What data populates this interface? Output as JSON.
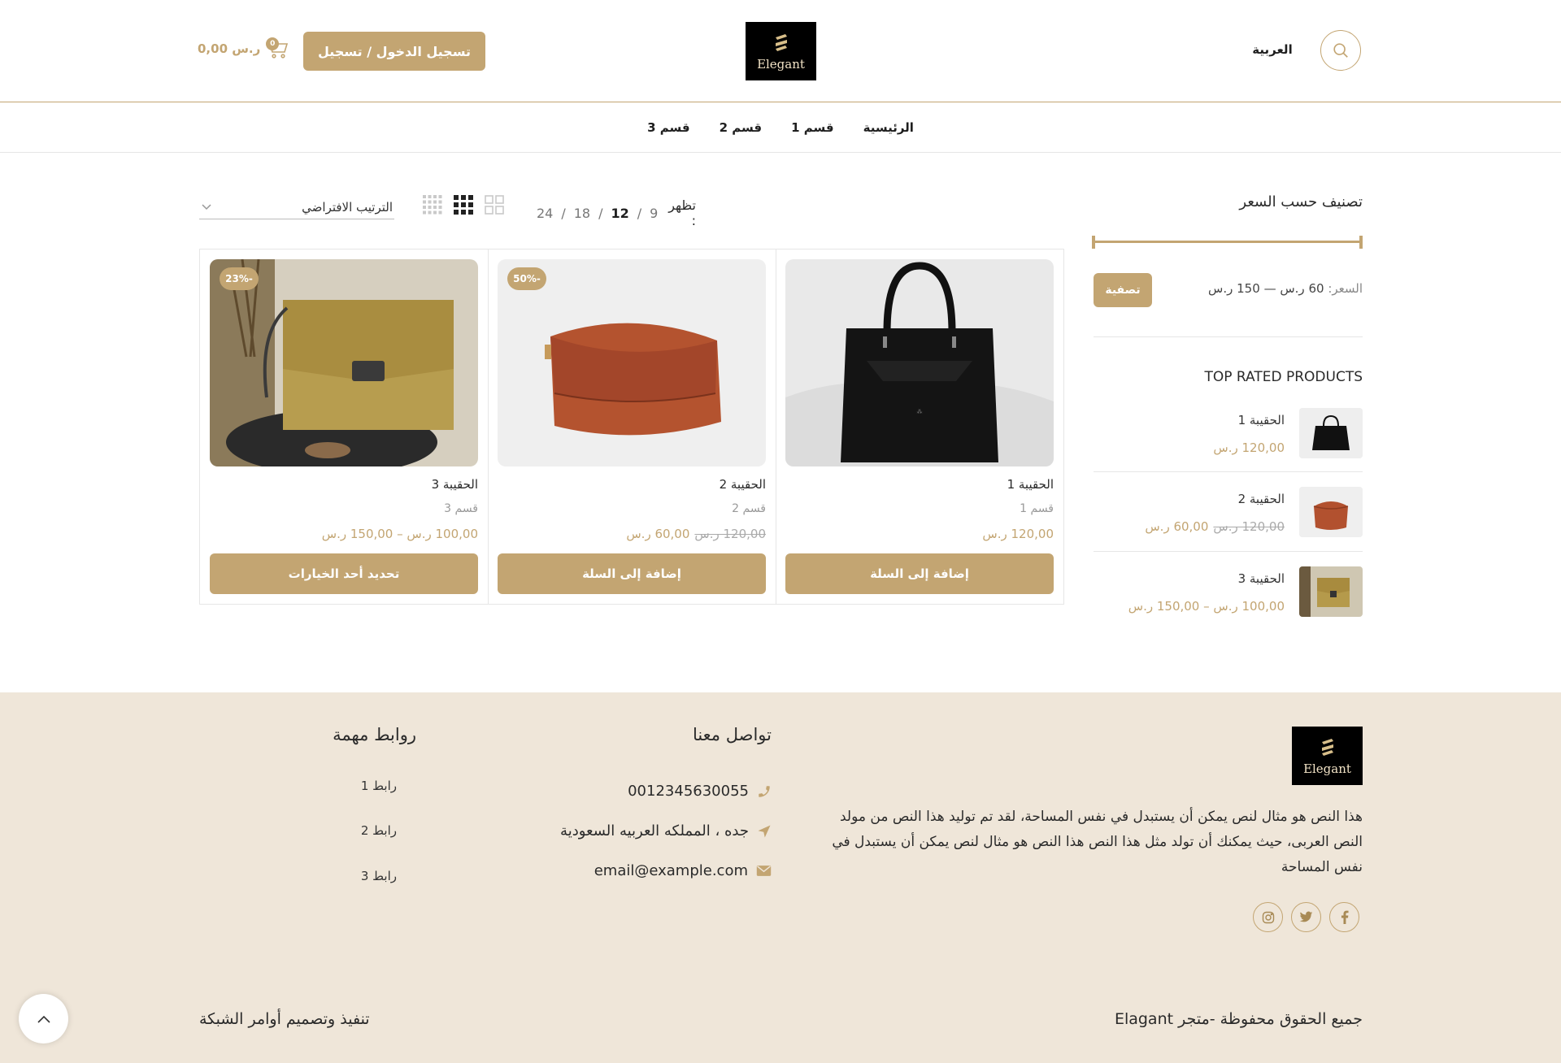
{
  "header": {
    "language": "العربية",
    "logo_text": "Elegant",
    "login_label": "تسجيل الدخول / تسجيل",
    "cart_total": "0,00 ر.س",
    "cart_count": "0"
  },
  "nav": {
    "items": [
      {
        "label": "الرئيسية"
      },
      {
        "label": "قسم 1"
      },
      {
        "label": "قسم 2"
      },
      {
        "label": "قسم 3"
      }
    ]
  },
  "sidebar": {
    "filter_title": "تصنيف حسب السعر",
    "price_label": "السعر:",
    "price_min": "60 ر.س",
    "price_sep": "—",
    "price_max": "150 ر.س",
    "filter_button": "تصفية",
    "top_rated_title": "TOP RATED PRODUCTS",
    "top_rated": [
      {
        "name": "الحقيبة 1",
        "price": "120,00 ر.س",
        "old_price": ""
      },
      {
        "name": "الحقيبة 2",
        "price": "60,00 ر.س",
        "old_price": "120,00 ر.س"
      },
      {
        "name": "الحقيبة 3",
        "price": "100,00 ر.س – 150,00 ر.س",
        "old_price": ""
      }
    ]
  },
  "toolbar": {
    "show_label": "تظهر :",
    "per_page_options": [
      "9",
      "12",
      "18",
      "24"
    ],
    "per_page_selected": "12",
    "separator": "/",
    "sort_value": "الترتيب الافتراضي"
  },
  "products": [
    {
      "name": "الحقيبة 1",
      "category": "قسم 1",
      "price": "120,00 ر.س",
      "old_price": "",
      "badge": "",
      "button": "إضافة إلى السلة"
    },
    {
      "name": "الحقيبة 2",
      "category": "قسم 2",
      "price": "60,00 ر.س",
      "old_price": "120,00 ر.س",
      "badge": "-50%",
      "button": "إضافة إلى السلة"
    },
    {
      "name": "الحقيبة 3",
      "category": "قسم 3",
      "price": "100,00 ر.س – 150,00 ر.س",
      "old_price": "",
      "badge": "-23%",
      "button": "تحديد أحد الخيارات"
    }
  ],
  "footer": {
    "logo_text": "Elegant",
    "about": "هذا النص هو مثال لنص يمكن أن يستبدل في نفس المساحة، لقد تم توليد هذا النص من مولد النص العربى، حيث يمكنك أن تولد مثل هذا النص هذا النص هو مثال لنص يمكن أن يستبدل في نفس المساحة",
    "contact_title": "تواصل معنا",
    "phone": "0012345630055",
    "address": "جده ، المملكه العربيه السعودية",
    "email": "email@example.com",
    "links_title": "روابط مهمة",
    "links": [
      {
        "label": "رابط 1"
      },
      {
        "label": "رابط 2"
      },
      {
        "label": "رابط 3"
      }
    ],
    "copyright": "جميع الحقوق محفوظة -متجر Elagant",
    "credit": "تنفيذ وتصميم أوامر الشبكة"
  },
  "colors": {
    "accent": "#c3a572",
    "footer_bg": "#efe6d9"
  }
}
